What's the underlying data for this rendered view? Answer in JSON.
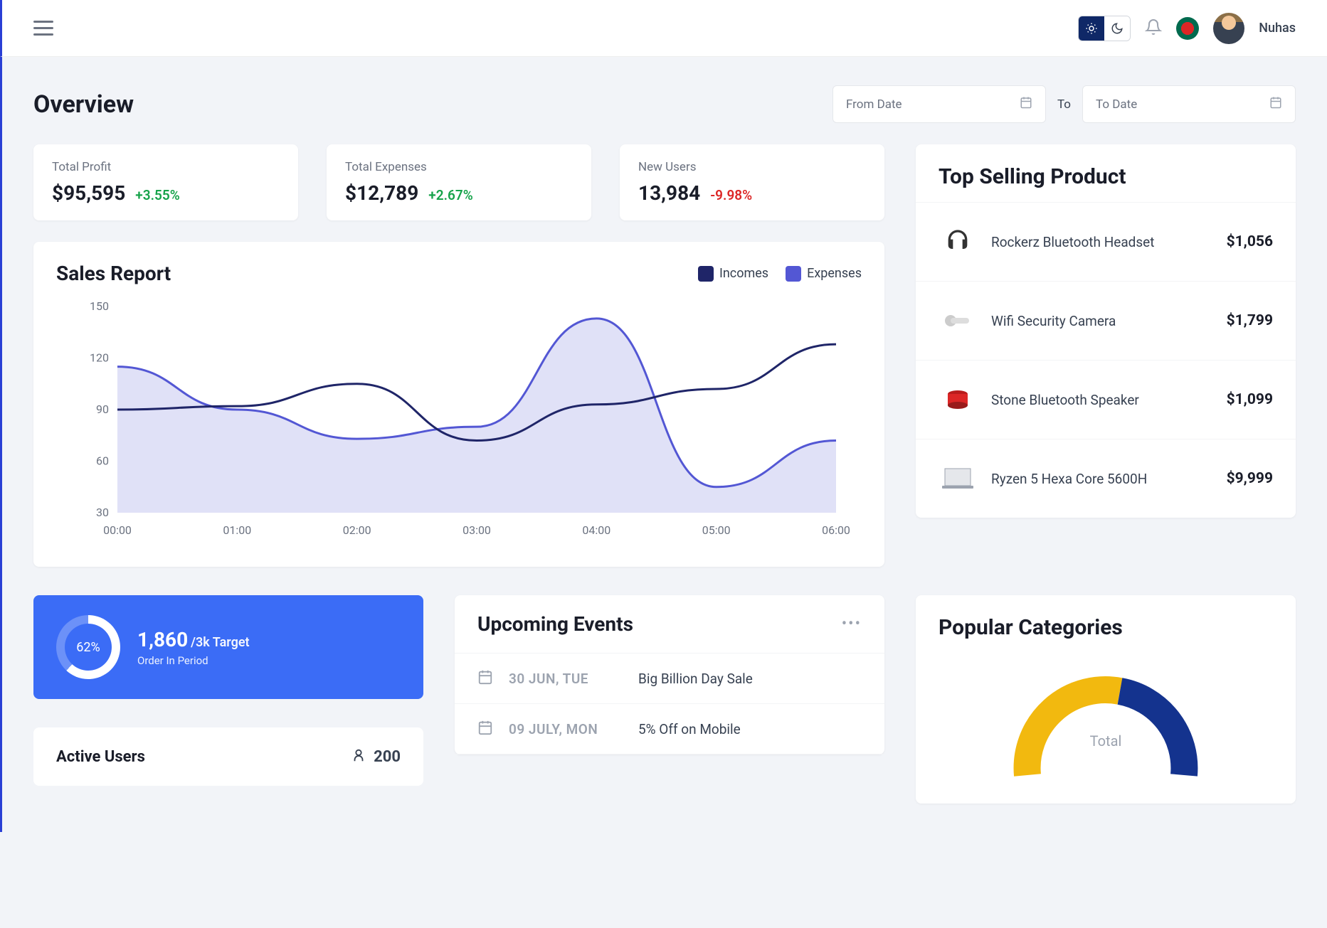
{
  "header": {
    "username": "Nuhas"
  },
  "page": {
    "title": "Overview",
    "from_placeholder": "From Date",
    "to_label": "To",
    "to_placeholder": "To Date"
  },
  "stats": [
    {
      "label": "Total Profit",
      "value": "$95,595",
      "delta": "+3.55%",
      "positive": true
    },
    {
      "label": "Total Expenses",
      "value": "$12,789",
      "delta": "+2.67%",
      "positive": true
    },
    {
      "label": "New Users",
      "value": "13,984",
      "delta": "-9.98%",
      "positive": false
    }
  ],
  "sales_report": {
    "title": "Sales Report",
    "legend": {
      "incomes": "Incomes",
      "expenses": "Expenses"
    },
    "colors": {
      "incomes": "#1f2568",
      "expenses": "#5357d4"
    }
  },
  "chart_data": {
    "type": "line",
    "title": "Sales Report",
    "xlabel": "",
    "ylabel": "",
    "ylim": [
      30,
      150
    ],
    "yticks": [
      30,
      60,
      90,
      120,
      150
    ],
    "categories": [
      "00:00",
      "01:00",
      "02:00",
      "03:00",
      "04:00",
      "05:00",
      "06:00"
    ],
    "series": [
      {
        "name": "Incomes",
        "color": "#1f2568",
        "values": [
          90,
          92,
          105,
          72,
          93,
          102,
          128
        ]
      },
      {
        "name": "Expenses",
        "color": "#5357d4",
        "values": [
          115,
          90,
          73,
          80,
          143,
          45,
          72
        ]
      }
    ]
  },
  "top_selling": {
    "title": "Top Selling Product",
    "products": [
      {
        "name": "Rockerz Bluetooth Headset",
        "price": "$1,056",
        "icon_color": "#333"
      },
      {
        "name": "Wifi Security Camera",
        "price": "$1,799",
        "icon_color": "#888"
      },
      {
        "name": "Stone Bluetooth Speaker",
        "price": "$1,099",
        "icon_color": "#dc2626"
      },
      {
        "name": "Ryzen 5 Hexa Core 5600H",
        "price": "$9,999",
        "icon_color": "#999"
      }
    ]
  },
  "target": {
    "percent": "62%",
    "value": "1,860",
    "suffix": "/3k Target",
    "label": "Order In Period"
  },
  "active_users": {
    "title": "Active Users",
    "count": "200"
  },
  "events": {
    "title": "Upcoming Events",
    "items": [
      {
        "date": "30 JUN, TUE",
        "name": "Big Billion Day Sale"
      },
      {
        "date": "09 JULY, MON",
        "name": "5% Off on Mobile"
      }
    ]
  },
  "popular_categories": {
    "title": "Popular Categories",
    "center_label": "Total"
  }
}
